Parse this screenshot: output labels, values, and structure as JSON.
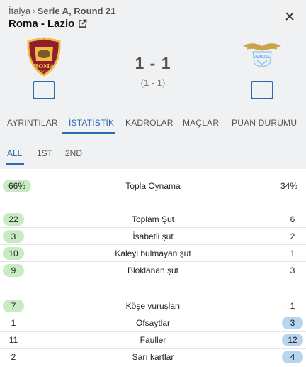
{
  "header": {
    "country": "İtalya",
    "separator": "›",
    "round": "Serie A, Round 21",
    "match_title": "Roma - Lazio",
    "home_logo": "roma-crest",
    "away_logo": "lazio-eagle-crest"
  },
  "score": {
    "full_time": "1 - 1",
    "half_time": "(1 - 1)"
  },
  "tabs": [
    {
      "label": "AYRINTILAR"
    },
    {
      "label": "İSTATİSTİK"
    },
    {
      "label": "KADROLAR"
    },
    {
      "label": "MAÇLAR"
    },
    {
      "label": "PUAN DURUMU"
    }
  ],
  "subtabs": [
    {
      "label": "ALL"
    },
    {
      "label": "1ST"
    },
    {
      "label": "2ND"
    }
  ],
  "stats": [
    {
      "label": "Topla Oynama",
      "home": "66%",
      "away": "34%",
      "leader": "home"
    },
    {
      "label": "Toplam Şut",
      "home": "22",
      "away": "6",
      "leader": "home"
    },
    {
      "label": "İsabetli şut",
      "home": "3",
      "away": "2",
      "leader": "home"
    },
    {
      "label": "Kaleyi bulmayan şut",
      "home": "10",
      "away": "1",
      "leader": "home"
    },
    {
      "label": "Bloklanan şut",
      "home": "9",
      "away": "3",
      "leader": "home"
    },
    {
      "label": "Köşe vuruşları",
      "home": "7",
      "away": "1",
      "leader": "home"
    },
    {
      "label": "Ofsaytlar",
      "home": "1",
      "away": "3",
      "leader": "away"
    },
    {
      "label": "Fauller",
      "home": "11",
      "away": "12",
      "leader": "away"
    },
    {
      "label": "Sarı kartlar",
      "home": "2",
      "away": "4",
      "leader": "away"
    }
  ],
  "colors": {
    "accent": "#2d6ab4",
    "home_highlight": "#c8ebc4",
    "away_highlight": "#b7d4f0",
    "header_bg": "#f0f1f3"
  }
}
